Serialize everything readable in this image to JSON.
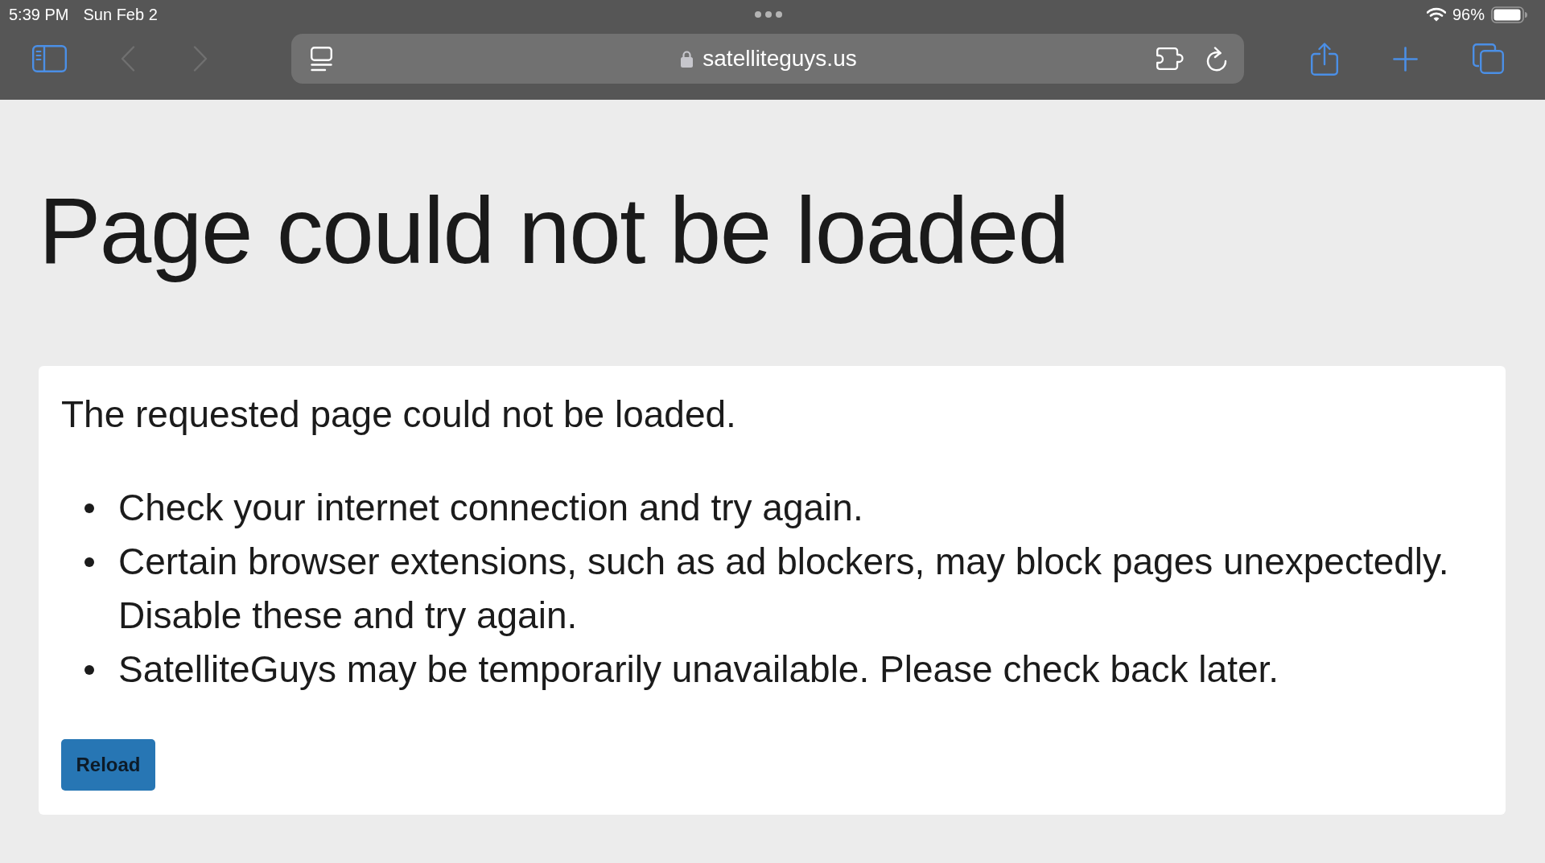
{
  "status_bar": {
    "time": "5:39 PM",
    "date": "Sun Feb 2",
    "battery": "96%"
  },
  "toolbar": {
    "nav_buttons": [
      {
        "kind": "back",
        "disabled": true
      },
      {
        "kind": "forward",
        "disabled": true
      }
    ],
    "address": "satelliteguys.us"
  },
  "page": {
    "heading": "Page could not be loaded",
    "message": "The requested page could not be loaded.",
    "tips": [
      "Check your internet connection and try again.",
      "Certain browser extensions, such as ad blockers, may block pages unexpectedly. Disable these and try again.",
      "SatelliteGuys may be temporarily unavailable. Please check back later."
    ],
    "button": "Reload"
  }
}
